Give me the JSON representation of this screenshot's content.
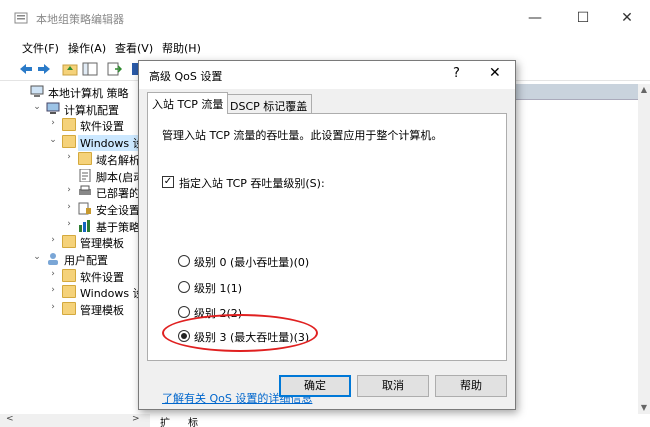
{
  "window": {
    "title": "本地组策略编辑器",
    "minimize": "—",
    "maximize": "☐",
    "close": "✕"
  },
  "menu": [
    "文件(F)",
    "操作(A)",
    "查看(V)",
    "帮助(H)"
  ],
  "tree": [
    {
      "label": "本地计算机 策略",
      "indent": 0,
      "arrow": "",
      "icon": "computer-icon"
    },
    {
      "label": "计算机配置",
      "indent": 1,
      "arrow": "⌄",
      "icon": "computer-config-icon"
    },
    {
      "label": "软件设置",
      "indent": 2,
      "arrow": "›",
      "icon": "folder-icon"
    },
    {
      "label": "Windows 设置",
      "indent": 2,
      "arrow": "⌄",
      "icon": "folder-icon",
      "selected": true
    },
    {
      "label": "域名解析策略",
      "indent": 3,
      "arrow": "›",
      "icon": "folder-icon"
    },
    {
      "label": "脚本(启动/关",
      "indent": 3,
      "arrow": "",
      "icon": "script-icon"
    },
    {
      "label": "已部署的打印",
      "indent": 3,
      "arrow": "›",
      "icon": "printer-icon"
    },
    {
      "label": "安全设置",
      "indent": 3,
      "arrow": "›",
      "icon": "security-icon"
    },
    {
      "label": "基于策略的 Q",
      "indent": 3,
      "arrow": "›",
      "icon": "qos-chart-icon"
    },
    {
      "label": "管理模板",
      "indent": 2,
      "arrow": "›",
      "icon": "folder-icon"
    },
    {
      "label": "用户配置",
      "indent": 1,
      "arrow": "⌄",
      "icon": "user-config-icon"
    },
    {
      "label": "软件设置",
      "indent": 2,
      "arrow": "›",
      "icon": "folder-icon"
    },
    {
      "label": "Windows 设置",
      "indent": 2,
      "arrow": "›",
      "icon": "folder-icon"
    },
    {
      "label": "管理模板",
      "indent": 2,
      "arrow": "›",
      "icon": "folder-icon"
    }
  ],
  "bottom_tabs": [
    "扩展",
    "标准"
  ],
  "dialog": {
    "title": "高级 QoS 设置",
    "help": "?",
    "close": "✕",
    "tabs": [
      "入站 TCP 流量",
      "DSCP 标记覆盖"
    ],
    "description": "管理入站 TCP 流量的吞吐量。此设置应用于整个计算机。",
    "checkbox_label": "指定入站 TCP 吞吐量级别(S):",
    "checkbox_checked": true,
    "checkmark": "✓",
    "radios": [
      {
        "label": "级别 0 (最小吞吐量)(0)",
        "checked": false
      },
      {
        "label": "级别 1(1)",
        "checked": false
      },
      {
        "label": "级别 2(2)",
        "checked": false
      },
      {
        "label": "级别 3 (最大吞吐量)(3)",
        "checked": true
      }
    ],
    "link": "了解有关 QoS 设置的详细信息",
    "buttons": {
      "ok": "确定",
      "cancel": "取消",
      "help": "帮助"
    }
  },
  "colors": {
    "accent": "#0078d7",
    "highlight_ellipse": "#e02020",
    "link": "#0066cc",
    "selection": "#cce8ff"
  }
}
